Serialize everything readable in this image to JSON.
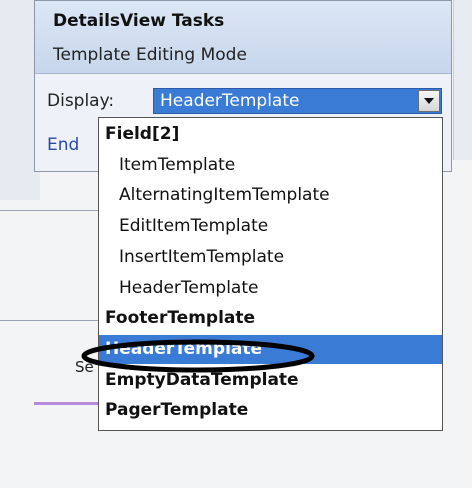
{
  "panel": {
    "title": "DetailsView Tasks",
    "subtitle": "Template Editing Mode",
    "display_label": "Display:",
    "end_link": "End"
  },
  "select": {
    "value": "HeaderTemplate"
  },
  "dropdown": {
    "items": [
      {
        "label": "Field[2]",
        "kind": "group",
        "selected": false
      },
      {
        "label": "ItemTemplate",
        "kind": "child",
        "selected": false
      },
      {
        "label": "AlternatingItemTemplate",
        "kind": "child",
        "selected": false
      },
      {
        "label": "EditItemTemplate",
        "kind": "child",
        "selected": false
      },
      {
        "label": "InsertItemTemplate",
        "kind": "child",
        "selected": false
      },
      {
        "label": "HeaderTemplate",
        "kind": "child",
        "selected": false
      },
      {
        "label": "FooterTemplate",
        "kind": "group",
        "selected": false
      },
      {
        "label": "HeaderTemplate",
        "kind": "group",
        "selected": true
      },
      {
        "label": "EmptyDataTemplate",
        "kind": "group",
        "selected": false
      },
      {
        "label": "PagerTemplate",
        "kind": "group",
        "selected": false
      }
    ]
  },
  "background": {
    "partial_text": "Se"
  },
  "colors": {
    "selection_blue": "#3a7bd5",
    "annotation_black": "#000000"
  }
}
